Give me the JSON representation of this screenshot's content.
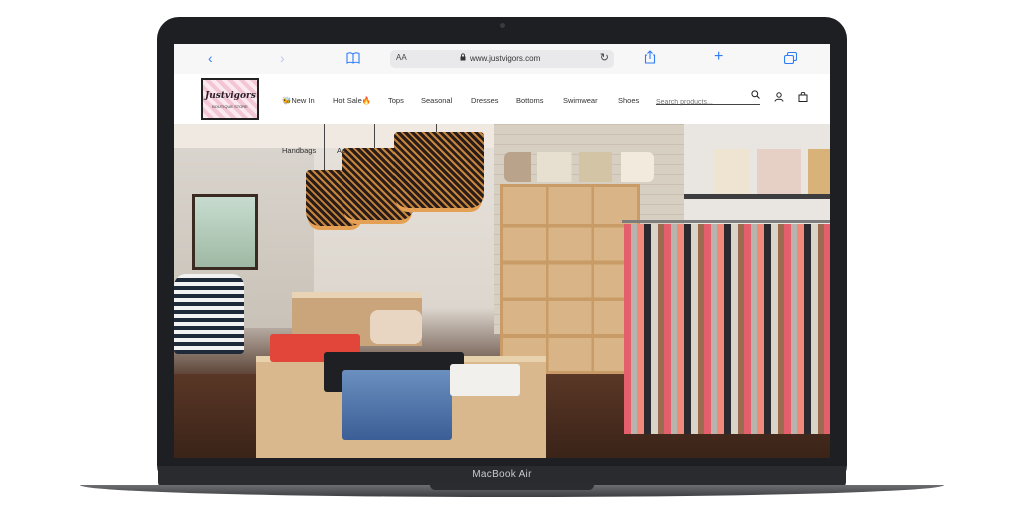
{
  "device": {
    "brand_label": "MacBook Air"
  },
  "browser": {
    "aa_label": "AA",
    "url": "www.justvigors.com",
    "icons": [
      "chevron-left-icon",
      "chevron-right-icon",
      "book-icon",
      "lock-icon",
      "reload-icon",
      "share-icon",
      "plus-icon",
      "tabs-icon"
    ]
  },
  "site": {
    "logo": {
      "name": "Justvigors",
      "tagline": "BOUTIQUE STORE"
    },
    "nav": [
      {
        "label": "🐝New In"
      },
      {
        "label": "Hot Sale🔥"
      },
      {
        "label": "Tops"
      },
      {
        "label": "Seasonal"
      },
      {
        "label": "Dresses"
      },
      {
        "label": "Bottoms"
      },
      {
        "label": "Swimwear"
      },
      {
        "label": "Shoes"
      }
    ],
    "subnav": [
      {
        "label": "Handbags"
      },
      {
        "label": "Ac"
      }
    ],
    "search": {
      "placeholder": "Search products..."
    },
    "header_icons": [
      "search-icon",
      "account-icon",
      "bag-icon"
    ]
  },
  "colors": {
    "browser_accent": "#2f7cf6",
    "laptop_body": "#1e1f22"
  }
}
